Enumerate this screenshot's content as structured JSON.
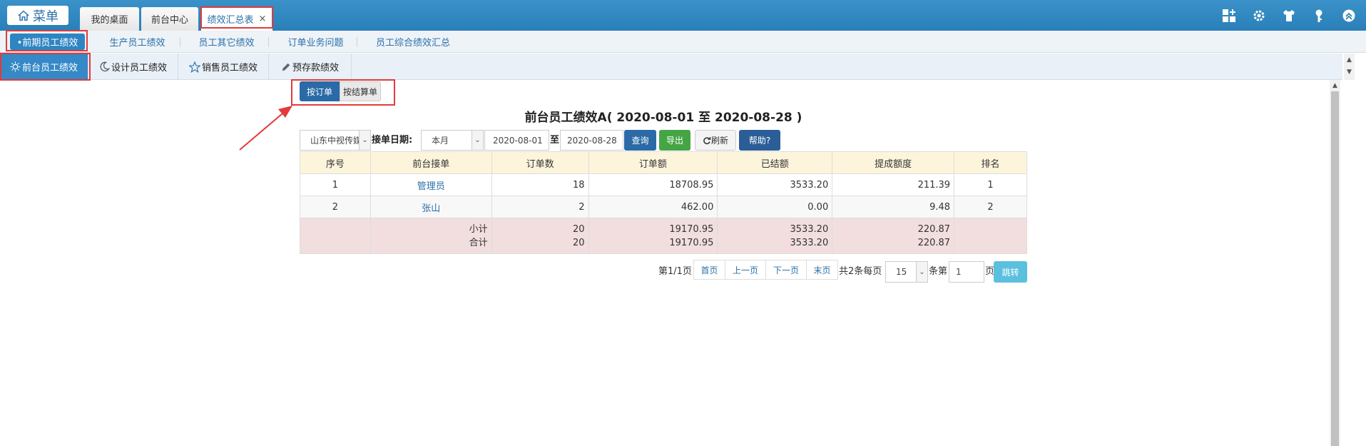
{
  "topbar": {
    "menu_label": "菜单",
    "tabs": [
      {
        "label": "我的桌面"
      },
      {
        "label": "前台中心"
      },
      {
        "label": "绩效汇总表",
        "close": "×"
      }
    ],
    "icons": [
      "add-widget-icon",
      "settings-gear-icon",
      "shirt-skin-icon",
      "key-icon",
      "collapse-up-icon"
    ]
  },
  "subnav": {
    "items": [
      {
        "label": "•前期员工绩效"
      },
      {
        "label": "生产员工绩效"
      },
      {
        "label": "员工其它绩效"
      },
      {
        "label": "订单业务问题"
      },
      {
        "label": "员工综合绩效汇总"
      }
    ]
  },
  "perfnav": {
    "items": [
      {
        "label": "前台员工绩效",
        "icon": "sun-icon"
      },
      {
        "label": "设计员工绩效",
        "icon": "moon-icon"
      },
      {
        "label": "销售员工绩效",
        "icon": "star-icon"
      },
      {
        "label": "预存款绩效",
        "icon": "pencil-icon"
      }
    ]
  },
  "view_toggle": {
    "by_order": "按订单",
    "by_settlement": "按结算单"
  },
  "report": {
    "title": "前台员工绩效A( 2020-08-01 至 2020-08-28 )"
  },
  "filters": {
    "company": "山东中视传媒",
    "date_label": "接单日期:",
    "period": "本月",
    "start_date": "2020-08-01",
    "to_label": "至",
    "end_date": "2020-08-28",
    "query": "查询",
    "export": "导出",
    "refresh": "刷新",
    "help": "帮助?"
  },
  "table": {
    "headers": [
      "序号",
      "前台接单",
      "订单数",
      "订单额",
      "已结额",
      "提成额度",
      "排名"
    ],
    "rows": [
      {
        "no": "1",
        "name": "管理员",
        "orders": "18",
        "amount": "18708.95",
        "settled": "3533.20",
        "commission": "211.39",
        "rank": "1"
      },
      {
        "no": "2",
        "name": "张山",
        "orders": "2",
        "amount": "462.00",
        "settled": "0.00",
        "commission": "9.48",
        "rank": "2"
      }
    ],
    "subtotal": {
      "label": "小计",
      "orders": "20",
      "amount": "19170.95",
      "settled": "3533.20",
      "commission": "220.87"
    },
    "total": {
      "label": "合计",
      "orders": "20",
      "amount": "19170.95",
      "settled": "3533.20",
      "commission": "220.87"
    }
  },
  "pagination": {
    "page_info": "第1/1页",
    "first": "首页",
    "prev": "上一页",
    "next": "下一页",
    "last": "末页",
    "total_info": "共2条每页",
    "page_size": "15",
    "records_label": "条第",
    "page_input": "1",
    "page_suffix": "页",
    "jump": "跳转"
  },
  "colors": {
    "highlight": "#e23a3a",
    "brand_blue": "#2a7fb8",
    "table_header": "#fcf5dc",
    "summary_row": "#f2dede"
  }
}
